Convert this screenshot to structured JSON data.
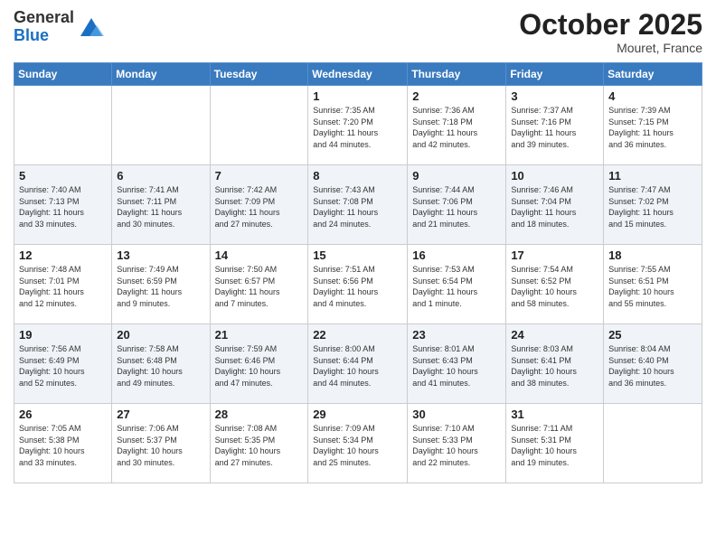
{
  "header": {
    "logo_line1": "General",
    "logo_line2": "Blue",
    "month": "October 2025",
    "location": "Mouret, France"
  },
  "weekdays": [
    "Sunday",
    "Monday",
    "Tuesday",
    "Wednesday",
    "Thursday",
    "Friday",
    "Saturday"
  ],
  "weeks": [
    [
      {
        "day": "",
        "detail": ""
      },
      {
        "day": "",
        "detail": ""
      },
      {
        "day": "",
        "detail": ""
      },
      {
        "day": "1",
        "detail": "Sunrise: 7:35 AM\nSunset: 7:20 PM\nDaylight: 11 hours\nand 44 minutes."
      },
      {
        "day": "2",
        "detail": "Sunrise: 7:36 AM\nSunset: 7:18 PM\nDaylight: 11 hours\nand 42 minutes."
      },
      {
        "day": "3",
        "detail": "Sunrise: 7:37 AM\nSunset: 7:16 PM\nDaylight: 11 hours\nand 39 minutes."
      },
      {
        "day": "4",
        "detail": "Sunrise: 7:39 AM\nSunset: 7:15 PM\nDaylight: 11 hours\nand 36 minutes."
      }
    ],
    [
      {
        "day": "5",
        "detail": "Sunrise: 7:40 AM\nSunset: 7:13 PM\nDaylight: 11 hours\nand 33 minutes."
      },
      {
        "day": "6",
        "detail": "Sunrise: 7:41 AM\nSunset: 7:11 PM\nDaylight: 11 hours\nand 30 minutes."
      },
      {
        "day": "7",
        "detail": "Sunrise: 7:42 AM\nSunset: 7:09 PM\nDaylight: 11 hours\nand 27 minutes."
      },
      {
        "day": "8",
        "detail": "Sunrise: 7:43 AM\nSunset: 7:08 PM\nDaylight: 11 hours\nand 24 minutes."
      },
      {
        "day": "9",
        "detail": "Sunrise: 7:44 AM\nSunset: 7:06 PM\nDaylight: 11 hours\nand 21 minutes."
      },
      {
        "day": "10",
        "detail": "Sunrise: 7:46 AM\nSunset: 7:04 PM\nDaylight: 11 hours\nand 18 minutes."
      },
      {
        "day": "11",
        "detail": "Sunrise: 7:47 AM\nSunset: 7:02 PM\nDaylight: 11 hours\nand 15 minutes."
      }
    ],
    [
      {
        "day": "12",
        "detail": "Sunrise: 7:48 AM\nSunset: 7:01 PM\nDaylight: 11 hours\nand 12 minutes."
      },
      {
        "day": "13",
        "detail": "Sunrise: 7:49 AM\nSunset: 6:59 PM\nDaylight: 11 hours\nand 9 minutes."
      },
      {
        "day": "14",
        "detail": "Sunrise: 7:50 AM\nSunset: 6:57 PM\nDaylight: 11 hours\nand 7 minutes."
      },
      {
        "day": "15",
        "detail": "Sunrise: 7:51 AM\nSunset: 6:56 PM\nDaylight: 11 hours\nand 4 minutes."
      },
      {
        "day": "16",
        "detail": "Sunrise: 7:53 AM\nSunset: 6:54 PM\nDaylight: 11 hours\nand 1 minute."
      },
      {
        "day": "17",
        "detail": "Sunrise: 7:54 AM\nSunset: 6:52 PM\nDaylight: 10 hours\nand 58 minutes."
      },
      {
        "day": "18",
        "detail": "Sunrise: 7:55 AM\nSunset: 6:51 PM\nDaylight: 10 hours\nand 55 minutes."
      }
    ],
    [
      {
        "day": "19",
        "detail": "Sunrise: 7:56 AM\nSunset: 6:49 PM\nDaylight: 10 hours\nand 52 minutes."
      },
      {
        "day": "20",
        "detail": "Sunrise: 7:58 AM\nSunset: 6:48 PM\nDaylight: 10 hours\nand 49 minutes."
      },
      {
        "day": "21",
        "detail": "Sunrise: 7:59 AM\nSunset: 6:46 PM\nDaylight: 10 hours\nand 47 minutes."
      },
      {
        "day": "22",
        "detail": "Sunrise: 8:00 AM\nSunset: 6:44 PM\nDaylight: 10 hours\nand 44 minutes."
      },
      {
        "day": "23",
        "detail": "Sunrise: 8:01 AM\nSunset: 6:43 PM\nDaylight: 10 hours\nand 41 minutes."
      },
      {
        "day": "24",
        "detail": "Sunrise: 8:03 AM\nSunset: 6:41 PM\nDaylight: 10 hours\nand 38 minutes."
      },
      {
        "day": "25",
        "detail": "Sunrise: 8:04 AM\nSunset: 6:40 PM\nDaylight: 10 hours\nand 36 minutes."
      }
    ],
    [
      {
        "day": "26",
        "detail": "Sunrise: 7:05 AM\nSunset: 5:38 PM\nDaylight: 10 hours\nand 33 minutes."
      },
      {
        "day": "27",
        "detail": "Sunrise: 7:06 AM\nSunset: 5:37 PM\nDaylight: 10 hours\nand 30 minutes."
      },
      {
        "day": "28",
        "detail": "Sunrise: 7:08 AM\nSunset: 5:35 PM\nDaylight: 10 hours\nand 27 minutes."
      },
      {
        "day": "29",
        "detail": "Sunrise: 7:09 AM\nSunset: 5:34 PM\nDaylight: 10 hours\nand 25 minutes."
      },
      {
        "day": "30",
        "detail": "Sunrise: 7:10 AM\nSunset: 5:33 PM\nDaylight: 10 hours\nand 22 minutes."
      },
      {
        "day": "31",
        "detail": "Sunrise: 7:11 AM\nSunset: 5:31 PM\nDaylight: 10 hours\nand 19 minutes."
      },
      {
        "day": "",
        "detail": ""
      }
    ]
  ]
}
